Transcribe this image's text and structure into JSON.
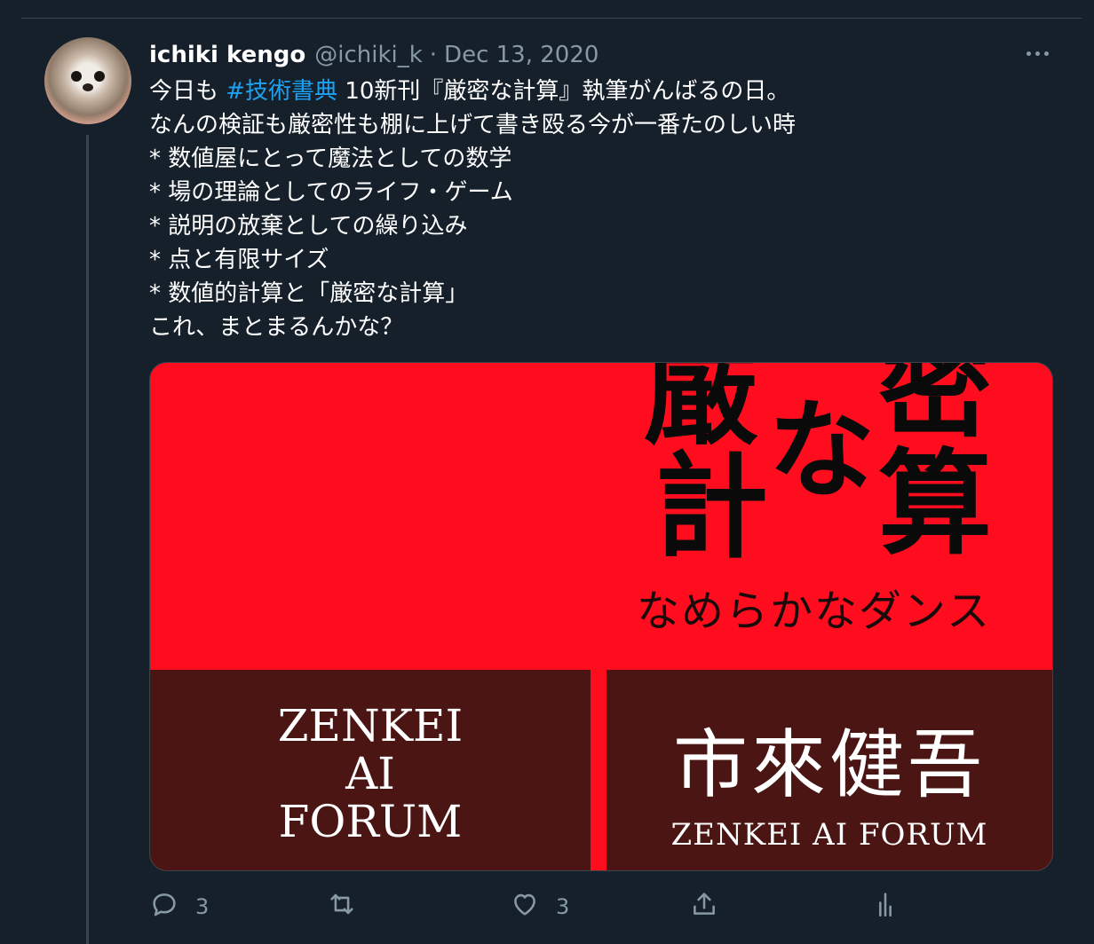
{
  "tweet": {
    "author_name": "ichiki kengo",
    "handle": "@ichiki_k",
    "separator": "·",
    "date": "Dec 13, 2020",
    "lines": {
      "l1_pre": "今日も ",
      "l1_tag": "#技術書典",
      "l1_post": " 10新刊『厳密な計算』執筆がんばるの日。",
      "l2": "なんの検証も厳密性も棚に上げて書き殴る今が一番たのしい時",
      "l3": "* 数値屋にとって魔法としての数学",
      "l4": "* 場の理論としてのライフ・ゲーム",
      "l5": "* 説明の放棄としての繰り込み",
      "l6": "* 点と有限サイズ",
      "l7": "* 数値的計算と「厳密な計算」",
      "l8": "これ、まとまるんかな？"
    }
  },
  "image": {
    "title_chars": {
      "c1": "厳",
      "c2": "密",
      "c3": "な",
      "c4": "計",
      "c5": "算"
    },
    "subtitle": "なめらかなダンス",
    "forum_lines": {
      "a": "ZENKEI",
      "b": "AI",
      "c": "FORUM"
    },
    "author": "市來健吾",
    "author_org": "ZENKEI  AI  FORUM"
  },
  "actions": {
    "reply_count": "3",
    "like_count": "3"
  },
  "icons": {
    "more": "more-horizontal-icon",
    "reply": "reply-icon",
    "retweet": "retweet-icon",
    "like": "heart-icon",
    "share": "share-icon",
    "analytics": "analytics-icon"
  },
  "colors": {
    "background": "#15202b",
    "accent": "#1da1f2",
    "muted": "#8899a6",
    "cover_red": "#ff0d1e",
    "cover_dark": "#4a1513"
  }
}
